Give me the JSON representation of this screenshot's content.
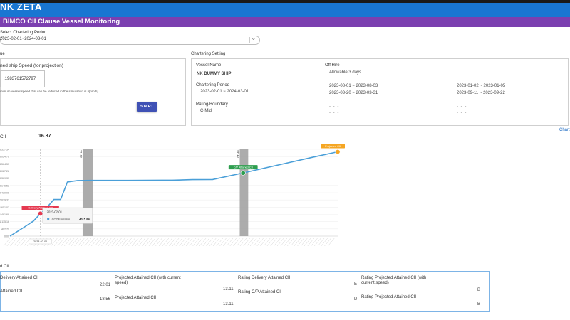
{
  "header": {
    "app_title": "NK ZETA",
    "page_title": "BIMCO CII Clause Vessel Monitoring"
  },
  "period_select": {
    "label": "Select Chartering Period",
    "value": "2023-02-01~2024-03-01"
  },
  "speed_section": {
    "section_label": "ue",
    "box_label": "ned ship Speed (for projection)",
    "input_value": ".1983761572797",
    "note": "inimum vessel speed that can be reduced in the simulation is 5[nm/h].",
    "start_label": "START"
  },
  "chartering": {
    "section_label": "Chartering Setting",
    "vessel_name_label": "Vessel Name",
    "vessel_name": "NK DUMMY SHIP",
    "period_label": "Chartering Period",
    "period_value": "2023-02-01 ~ 2024-03-01",
    "rating_label": "Rating/Boundary",
    "rating_value": "C-Mid",
    "off_hire_label": "Off Hire",
    "allowable": "Allowable 3 days",
    "off_hire_periods": [
      "2023-08-01 ~ 2023-08-03",
      "2023-03-20 ~ 2023-03-31",
      "2023-01-02 ~ 2023-01-05",
      "2023-09-11 ~ 2023-09-22"
    ],
    "dash": "- - -"
  },
  "chart_link": "Chart",
  "chart_data": {
    "type": "line",
    "title": "CII",
    "value_label": "16.37",
    "ylim": [
      0,
      5700
    ],
    "y_ticks": [
      "0.00",
      "402.79",
      "1,115.16",
      "1,481.69",
      "1,651.03",
      "2,039.31",
      "2,439.06",
      "3,146.52",
      "3,369.33",
      "4,027.28",
      "4,564.53",
      "5,024.76",
      "5,537.54"
    ],
    "x_marked": "2023-02-01",
    "series": [
      {
        "name": "CO2 Emission",
        "points": [
          [
            0,
            0
          ],
          [
            2,
            280
          ],
          [
            4,
            560
          ],
          [
            5,
            700
          ],
          [
            7,
            1000
          ],
          [
            9,
            1480
          ],
          [
            11,
            1900
          ],
          [
            13,
            2400
          ],
          [
            15,
            2400
          ],
          [
            17,
            3550
          ],
          [
            20,
            3650
          ],
          [
            24,
            3660
          ],
          [
            35,
            3660
          ],
          [
            45,
            3670
          ],
          [
            48,
            3670
          ],
          [
            54,
            3710
          ],
          [
            60,
            3720
          ],
          [
            70,
            4200
          ],
          [
            80,
            4700
          ],
          [
            90,
            5200
          ],
          [
            97,
            5537
          ]
        ]
      }
    ],
    "off_hire_ranges": [
      [
        21.5,
        24.5
      ],
      [
        68,
        70.5
      ]
    ],
    "off_hire_label": "Off Hire",
    "markers": [
      {
        "label": "Delivery Attained CII",
        "x": 9,
        "y": 1480,
        "color": "#e53950"
      },
      {
        "label": "C/P Attained CII",
        "x": 69,
        "y": 4150,
        "color": "#2e9e4f"
      },
      {
        "label": "Projected CII",
        "x": 97,
        "y": 5537,
        "color": "#f5a623"
      }
    ],
    "tooltip": {
      "date": "2023-02-01",
      "series": "CO2 Emission",
      "value": "4015.84"
    },
    "x_axis_tooltip": "2023-02-01",
    "line_color": "#4a9fd8"
  },
  "summary": {
    "section_label": "d CII",
    "items": [
      {
        "label": "Delivery Attained CII",
        "value": "22.01"
      },
      {
        "label": "Attained CII",
        "value": "18.56"
      },
      {
        "label": "Projected Attained CII (with current speed)",
        "value": "13.11"
      },
      {
        "label": "Projected Attained CII",
        "value": "13.11"
      },
      {
        "label": "Rating Delivery Attained CII",
        "value": "E"
      },
      {
        "label": "Rating C/P Attained CII",
        "value": "D"
      },
      {
        "label": "Rating Projected Attained CII (with current speed)",
        "value": "B"
      },
      {
        "label": "Rating Projected Attained CII",
        "value": "B"
      }
    ]
  }
}
